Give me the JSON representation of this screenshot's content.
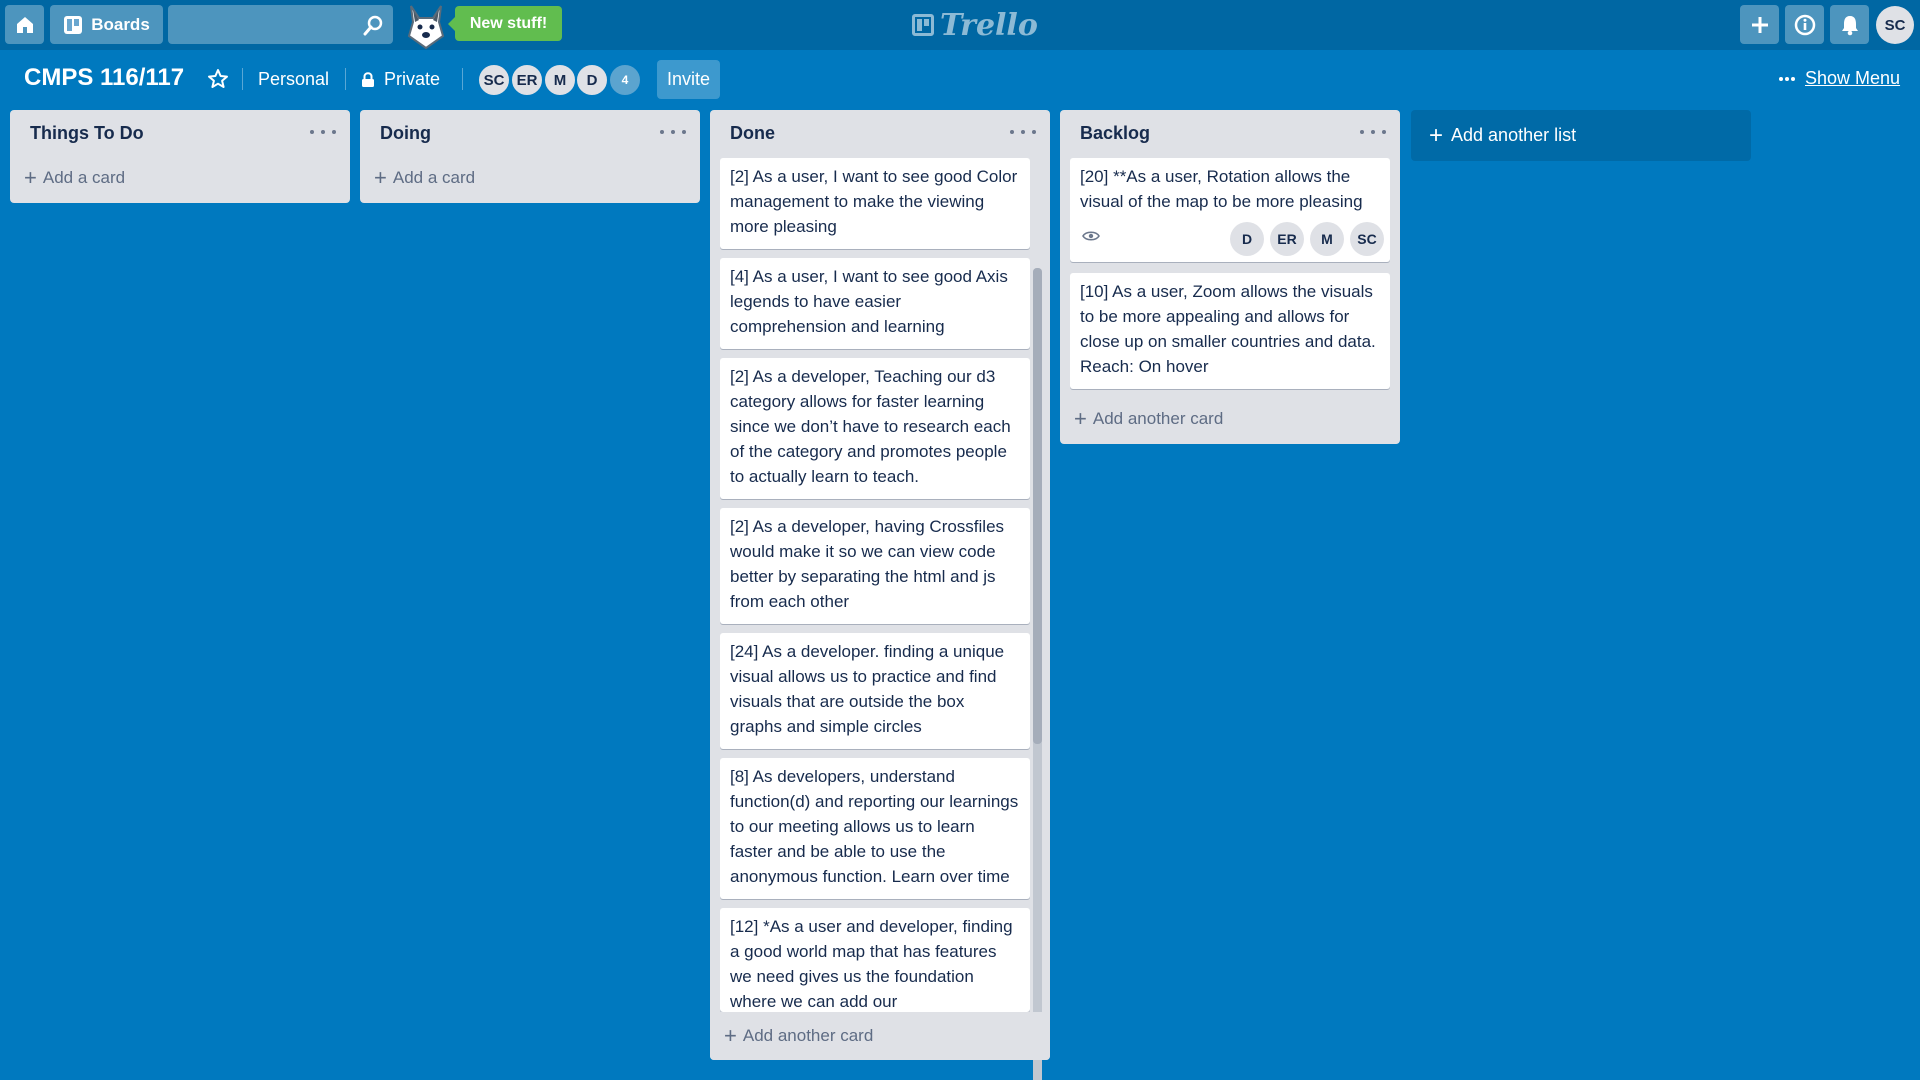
{
  "header": {
    "boards_label": "Boards",
    "new_stuff_label": "New stuff!",
    "logo_text": "Trello",
    "user_initials": "SC"
  },
  "board": {
    "title": "CMPS 116/117",
    "team": "Personal",
    "visibility": "Private",
    "members": [
      "SC",
      "ER",
      "M",
      "D"
    ],
    "extra_members": "4",
    "invite_label": "Invite",
    "show_menu_label": "Show Menu"
  },
  "lists": [
    {
      "title": "Things To Do",
      "add_label": "Add a card",
      "cards": []
    },
    {
      "title": "Doing",
      "add_label": "Add a card",
      "cards": []
    },
    {
      "title": "Done",
      "add_label": "Add another card",
      "cards": [
        "[2] As a user, I want to see good Color management to make the viewing more pleasing",
        "[4] As a user, I want to see good Axis legends to have easier comprehension and learning",
        "[2] As a developer, Teaching our d3 category allows for faster learning since we don’t have to research each of the category and promotes people to actually learn to teach.",
        "[2] As a developer, having Crossfiles would make it so we can view code better by separating the html and js from each other",
        "[24] As a developer. finding a unique visual allows us to practice and find visuals that are outside the box graphs and simple circles",
        "[8] As developers, understand function(d) and reporting our learnings to our meeting allows us to learn faster and be able to use the anonymous function. Learn over time",
        "[12] *As a user and developer, finding a good world map that has features we need gives us the foundation where we can add our"
      ]
    },
    {
      "title": "Backlog",
      "add_label": "Add another card",
      "cards": [
        "[20] **As a user, Rotation allows the visual of the map to be more pleasing",
        "[10] As a user, Zoom allows the visuals to be more appealing and allows for close up on smaller countries and data. Reach: On hover"
      ],
      "card_members": [
        "D",
        "ER",
        "M",
        "SC"
      ]
    }
  ],
  "add_list_label": "Add another list",
  "icons": [
    "home-icon",
    "boards-icon",
    "search-icon",
    "plus-icon",
    "info-icon",
    "bell-icon",
    "star-icon",
    "lock-icon",
    "ellipsis-icon",
    "eye-icon"
  ]
}
